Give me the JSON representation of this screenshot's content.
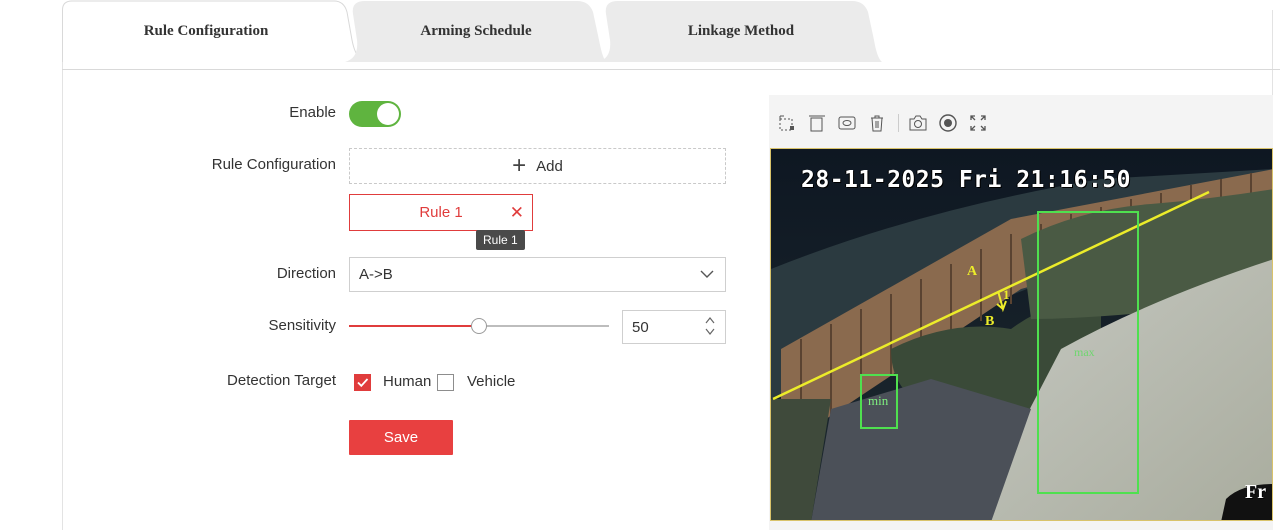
{
  "tabs": [
    {
      "label": "Rule Configuration",
      "active": true
    },
    {
      "label": "Arming Schedule",
      "active": false
    },
    {
      "label": "Linkage Method",
      "active": false
    }
  ],
  "form": {
    "enable_label": "Enable",
    "enable_on": true,
    "rule_config_label": "Rule Configuration",
    "add_label": "Add",
    "rule_chip": "Rule 1",
    "tooltip": "Rule 1",
    "direction_label": "Direction",
    "direction_value": "A->B",
    "sensitivity_label": "Sensitivity",
    "sensitivity_value": "50",
    "sensitivity_fraction": 0.5,
    "detection_label": "Detection Target",
    "targets": [
      {
        "label": "Human",
        "checked": true
      },
      {
        "label": "Vehicle",
        "checked": false
      }
    ],
    "save_label": "Save"
  },
  "video": {
    "toolbar_icons": [
      "draw-area-icon",
      "draw-min-size-icon",
      "draw-max-size-icon",
      "delete-icon",
      "snapshot-icon",
      "record-icon",
      "fullscreen-icon"
    ],
    "osd_datetime": "28-11-2025 Fri 21:16:50",
    "osd_corner": "Fr",
    "line_label_a": "A",
    "line_label_b": "B",
    "line_label_num": "1",
    "min_label": "min",
    "max_label": "max"
  },
  "colors": {
    "accent": "#e03c3c",
    "toggle": "#5fb43f",
    "overlay_line": "#ecec2a",
    "overlay_box": "#4fe04f"
  }
}
